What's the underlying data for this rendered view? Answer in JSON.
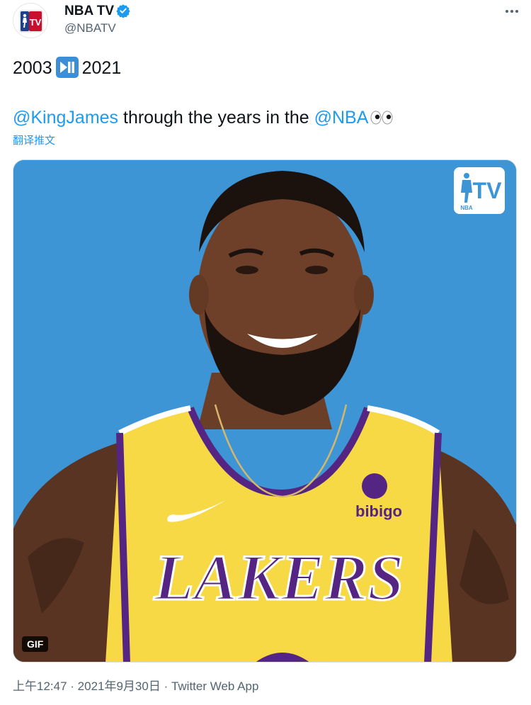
{
  "header": {
    "display_name": "NBA TV",
    "handle": "@NBATV",
    "avatar_text": "TV",
    "verified": true
  },
  "tweet": {
    "line1_prefix": "2003",
    "line1_suffix": "2021",
    "line1_emoji": "play-pause-button",
    "mention1": "@KingJames",
    "mid_text": " through the years in the ",
    "mention2": "@NBA",
    "trailing_emoji": "eyes",
    "translate_label": "翻译推文"
  },
  "media": {
    "badge": "GIF",
    "watermark_text": "TV",
    "watermark_sub": "NBA",
    "jersey_text": "LAKERS",
    "sponsor_text": "bibigo",
    "background_color": "#3e95d6",
    "jersey_color": "#f7d845",
    "trim_color": "#552583"
  },
  "meta": {
    "time": "上午12:47",
    "separator": " · ",
    "date": "2021年9月30日",
    "source": "Twitter Web App"
  },
  "colors": {
    "link": "#1d9bf0",
    "secondary_text": "#536471",
    "primary_text": "#0f1419"
  }
}
